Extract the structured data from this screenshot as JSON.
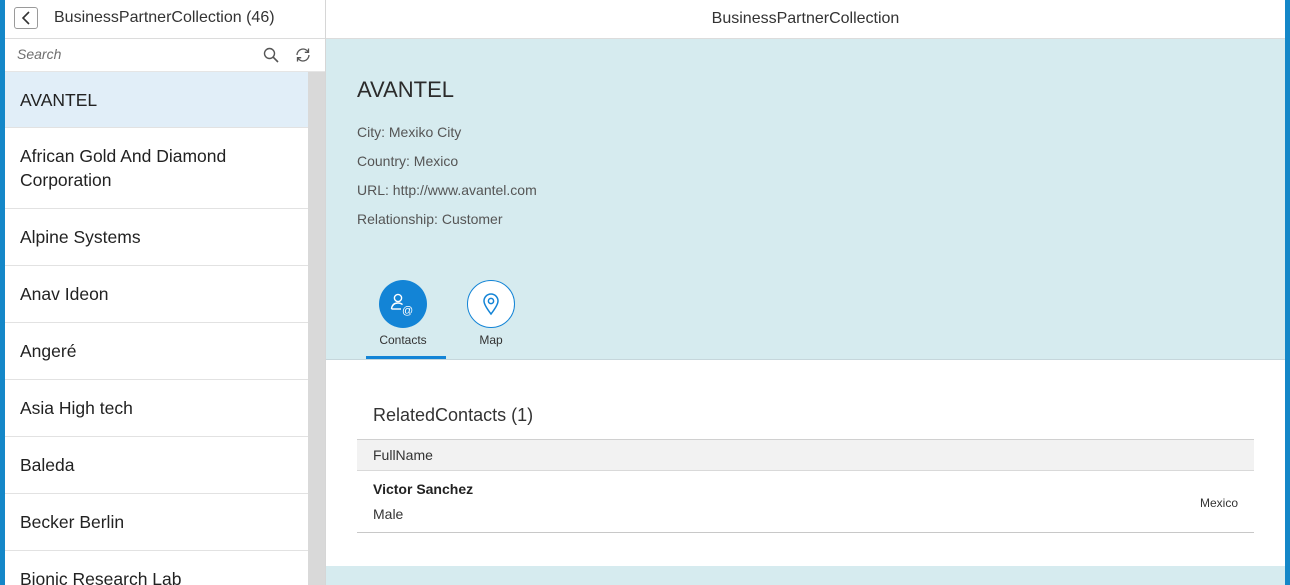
{
  "master": {
    "title": "BusinessPartnerCollection (46)",
    "search_placeholder": "Search",
    "items": [
      {
        "label": "AVANTEL"
      },
      {
        "label": "African Gold And Diamond Corporation"
      },
      {
        "label": "Alpine Systems"
      },
      {
        "label": "Anav Ideon"
      },
      {
        "label": "Angeré"
      },
      {
        "label": "Asia High tech"
      },
      {
        "label": "Baleda"
      },
      {
        "label": "Becker Berlin"
      },
      {
        "label": "Bionic Research Lab"
      }
    ]
  },
  "detail": {
    "header_title": "BusinessPartnerCollection",
    "object": {
      "title": "AVANTEL",
      "city": "City: Mexiko City",
      "country": "Country: Mexico",
      "url": "URL: http://www.avantel.com",
      "relationship": "Relationship: Customer"
    },
    "tabs": [
      {
        "label": "Contacts",
        "icon": "contacts-icon"
      },
      {
        "label": "Map",
        "icon": "map-pin-icon"
      }
    ],
    "related": {
      "title": "RelatedContacts (1)",
      "columns": [
        "FullName"
      ],
      "rows": [
        {
          "name": "Victor Sanchez",
          "gender": "Male",
          "country": "Mexico"
        }
      ]
    }
  },
  "colors": {
    "accent": "#1384d6",
    "header_bg": "#d6ebef",
    "selected_bg": "#e1eef8",
    "frame": "#1487c8"
  }
}
